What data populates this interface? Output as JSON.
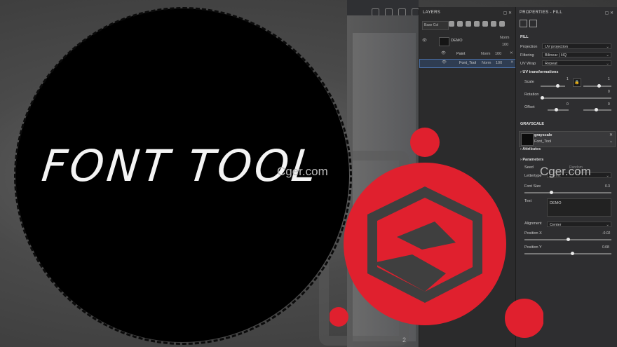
{
  "headline": "FONT TOOL",
  "watermark": "Cger.com",
  "viewport": {
    "page_number": "2"
  },
  "layers": {
    "title": "LAYERS",
    "blend_select": "Base Col",
    "rows": [
      {
        "name": "DEMO",
        "blend": "Norm",
        "opacity": "100"
      },
      {
        "name": "Paint",
        "blend": "Norm",
        "opacity": "100"
      },
      {
        "name": "Font_Tool",
        "blend": "Norm",
        "opacity": "100"
      }
    ]
  },
  "properties": {
    "title": "PROPERTIES - FILL",
    "fill_section": "FILL",
    "projection_label": "Projection",
    "projection_value": "UV projection",
    "filtering_label": "Filtering",
    "filtering_value": "Bilinear | HQ",
    "uvwrap_label": "UV Wrap",
    "uvwrap_value": "Repeat",
    "uv_transform_section": "UV transformations",
    "scale_label": "Scale",
    "scale_value_a": "1",
    "scale_value_b": "1",
    "rotation_label": "Rotation",
    "rotation_value": "0",
    "offset_label": "Offset",
    "offset_value_a": "0",
    "offset_value_b": "0",
    "grayscale_section": "GRAYSCALE",
    "grayscale_name": "grayscale",
    "grayscale_sub": "Font_Tool",
    "attributes_section": "Attributes",
    "parameters_section": "Parameters",
    "seed_label": "Seed",
    "seed_value": "Random",
    "lettertype_label": "Lettertype",
    "lettertype_value": "Comic",
    "fontsize_label": "Font Size",
    "fontsize_value": "0.3",
    "text_label": "Text",
    "text_value": "DEMO",
    "alignment_label": "Alignment",
    "alignment_value": "Center",
    "posx_label": "Position X",
    "posx_value": "-0.02",
    "posy_label": "Position Y",
    "posy_value": "0.08"
  },
  "colors": {
    "logo_red": "#e0202e",
    "panel_bg": "#2e2e30",
    "selection": "#4a6fa5"
  },
  "icons": [
    "eye-icon",
    "lock-icon",
    "close-icon",
    "chevron-down-icon",
    "brush-icon"
  ]
}
